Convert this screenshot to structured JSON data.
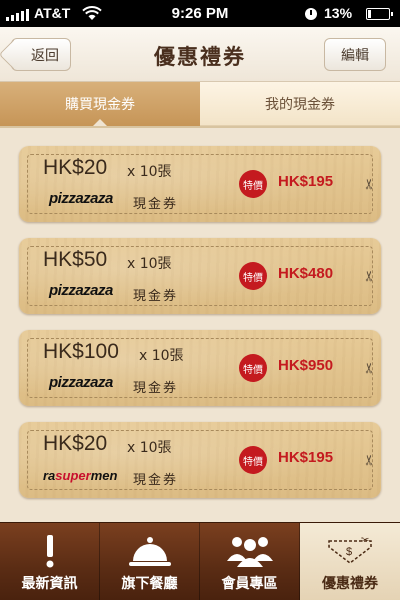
{
  "status_bar": {
    "carrier": "AT&T",
    "time": "9:26 PM",
    "battery": "13%",
    "battery_level": 0.13
  },
  "header": {
    "title": "優惠禮券",
    "back_label": "返回",
    "edit_label": "編輯"
  },
  "tabs": [
    {
      "label": "購買現金券",
      "active": true
    },
    {
      "label": "我的現金券",
      "active": false
    }
  ],
  "coupons": [
    {
      "amount": "HK$20",
      "qty": "x 10張",
      "brand": "pizzazaza",
      "cash_label": "現金券",
      "special_label": "特價",
      "price": "HK$195"
    },
    {
      "amount": "HK$50",
      "qty": "x 10張",
      "brand": "pizzazaza",
      "cash_label": "現金券",
      "special_label": "特價",
      "price": "HK$480"
    },
    {
      "amount": "HK$100",
      "qty": "x 10張",
      "brand": "pizzazaza",
      "cash_label": "現金券",
      "special_label": "特價",
      "price": "HK$950"
    },
    {
      "amount": "HK$20",
      "qty": "x 10張",
      "brand": "rasupermen",
      "cash_label": "現金券",
      "special_label": "特價",
      "price": "HK$195"
    }
  ],
  "tab_bar": [
    {
      "label": "最新資訊",
      "icon": "exclamation-icon",
      "active": false
    },
    {
      "label": "旗下餐廳",
      "icon": "cloche-icon",
      "active": false
    },
    {
      "label": "會員專區",
      "icon": "members-icon",
      "active": false
    },
    {
      "label": "優惠禮券",
      "icon": "coupon-icon",
      "active": true
    }
  ],
  "colors": {
    "accent_red": "#c41a1f",
    "tab_active": "#c69557",
    "tab_bar_bg": "#5a2c14"
  }
}
